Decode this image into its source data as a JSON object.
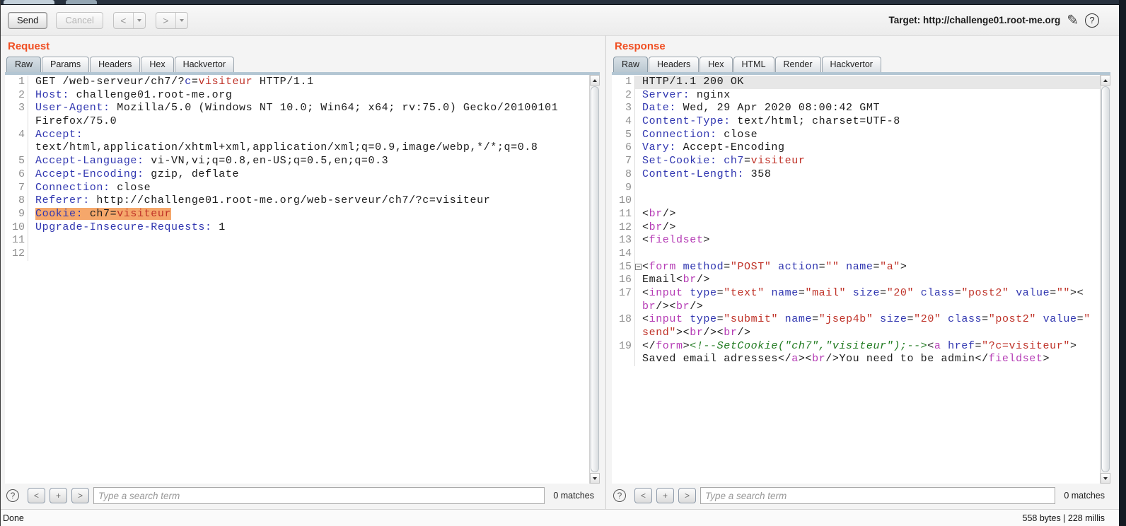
{
  "toolbar": {
    "send_label": "Send",
    "cancel_label": "Cancel",
    "prev_label": "<",
    "next_label": ">",
    "target_label": "Target: http://challenge01.root-me.org"
  },
  "request": {
    "title": "Request",
    "tabs": [
      {
        "label": "Raw",
        "active": true
      },
      {
        "label": "Params"
      },
      {
        "label": "Headers"
      },
      {
        "label": "Hex"
      },
      {
        "label": "Hackvertor"
      }
    ],
    "rows": [
      {
        "n": "1",
        "tk": [
          [
            "GET /web-serveur/ch7/?",
            "t"
          ],
          [
            "c",
            "h"
          ],
          [
            "=",
            "t"
          ],
          [
            "visiteur",
            "v"
          ],
          [
            " HTTP/1.1",
            "t"
          ]
        ]
      },
      {
        "n": "2",
        "tk": [
          [
            "Host:",
            "h"
          ],
          [
            " challenge01.root-me.org",
            "t"
          ]
        ]
      },
      {
        "n": "3",
        "tk": [
          [
            "User-Agent:",
            "h"
          ],
          [
            " Mozilla/5.0 (Windows NT 10.0; Win64; x64; rv:75.0) Gecko/20100101",
            "t"
          ]
        ]
      },
      {
        "n": "",
        "tk": [
          [
            "Firefox/75.0",
            "t"
          ]
        ]
      },
      {
        "n": "4",
        "tk": [
          [
            "Accept:",
            "h"
          ]
        ]
      },
      {
        "n": "",
        "tk": [
          [
            "text/html,application/xhtml+xml,application/xml;q=0.9,image/webp,*/*;q=0.8",
            "t"
          ]
        ]
      },
      {
        "n": "5",
        "tk": [
          [
            "Accept-Language:",
            "h"
          ],
          [
            " vi-VN,vi;q=0.8,en-US;q=0.5,en;q=0.3",
            "t"
          ]
        ]
      },
      {
        "n": "6",
        "tk": [
          [
            "Accept-Encoding:",
            "h"
          ],
          [
            " gzip, deflate",
            "t"
          ]
        ]
      },
      {
        "n": "7",
        "tk": [
          [
            "Connection:",
            "h"
          ],
          [
            " close",
            "t"
          ]
        ]
      },
      {
        "n": "8",
        "tk": [
          [
            "Referer:",
            "h"
          ],
          [
            " http://challenge01.root-me.org/web-serveur/ch7/?c=visiteur",
            "t"
          ]
        ]
      },
      {
        "n": "9",
        "hl": true,
        "tk": [
          [
            "Cookie:",
            "h"
          ],
          [
            " ch7=",
            "t"
          ],
          [
            "visiteur",
            "v"
          ]
        ]
      },
      {
        "n": "10",
        "tk": [
          [
            "Upgrade-Insecure-Requests:",
            "h"
          ],
          [
            " 1",
            "t"
          ]
        ]
      },
      {
        "n": "11",
        "tk": []
      },
      {
        "n": "12",
        "tk": []
      }
    ],
    "search": {
      "prev": "<",
      "case": "+",
      "next": ">",
      "placeholder": "Type a search term",
      "matches": "0 matches"
    }
  },
  "response": {
    "title": "Response",
    "tabs": [
      {
        "label": "Raw",
        "active": true
      },
      {
        "label": "Headers"
      },
      {
        "label": "Hex"
      },
      {
        "label": "HTML"
      },
      {
        "label": "Render"
      },
      {
        "label": "Hackvertor"
      }
    ],
    "rows": [
      {
        "n": "1",
        "cur": true,
        "tk": [
          [
            "HTTP/1.1 200 OK",
            "t"
          ]
        ]
      },
      {
        "n": "2",
        "tk": [
          [
            "Server:",
            "h"
          ],
          [
            " nginx",
            "t"
          ]
        ]
      },
      {
        "n": "3",
        "tk": [
          [
            "Date:",
            "h"
          ],
          [
            " Wed, 29 Apr 2020 08:00:42 GMT",
            "t"
          ]
        ]
      },
      {
        "n": "4",
        "tk": [
          [
            "Content-Type:",
            "h"
          ],
          [
            " text/html; charset=UTF-8",
            "t"
          ]
        ]
      },
      {
        "n": "5",
        "tk": [
          [
            "Connection:",
            "h"
          ],
          [
            " close",
            "t"
          ]
        ]
      },
      {
        "n": "6",
        "tk": [
          [
            "Vary:",
            "h"
          ],
          [
            " Accept-Encoding",
            "t"
          ]
        ]
      },
      {
        "n": "7",
        "tk": [
          [
            "Set-Cookie:",
            "h"
          ],
          [
            " ",
            "t"
          ],
          [
            "ch7",
            "h"
          ],
          [
            "=",
            "t"
          ],
          [
            "visiteur",
            "v"
          ]
        ]
      },
      {
        "n": "8",
        "tk": [
          [
            "Content-Length:",
            "h"
          ],
          [
            " 358",
            "t"
          ]
        ]
      },
      {
        "n": "9",
        "tk": []
      },
      {
        "n": "10",
        "tk": []
      },
      {
        "n": "11",
        "tk": [
          [
            "<",
            "t"
          ],
          [
            "br",
            "g"
          ],
          [
            "/>",
            "t"
          ]
        ]
      },
      {
        "n": "12",
        "tk": [
          [
            "<",
            "t"
          ],
          [
            "br",
            "g"
          ],
          [
            "/>",
            "t"
          ]
        ]
      },
      {
        "n": "13",
        "tk": [
          [
            "<",
            "t"
          ],
          [
            "fieldset",
            "g"
          ],
          [
            ">",
            "t"
          ]
        ]
      },
      {
        "n": "14",
        "tk": []
      },
      {
        "n": "15",
        "fold": true,
        "tk": [
          [
            "<",
            "t"
          ],
          [
            "form",
            "g"
          ],
          [
            " ",
            "t"
          ],
          [
            "method",
            "h"
          ],
          [
            "=",
            "t"
          ],
          [
            "\"POST\"",
            "v"
          ],
          [
            " ",
            "t"
          ],
          [
            "action",
            "h"
          ],
          [
            "=",
            "t"
          ],
          [
            "\"\"",
            "v"
          ],
          [
            " ",
            "t"
          ],
          [
            "name",
            "h"
          ],
          [
            "=",
            "t"
          ],
          [
            "\"a\"",
            "v"
          ],
          [
            ">",
            "t"
          ]
        ]
      },
      {
        "n": "16",
        "tk": [
          [
            "Email",
            "t"
          ],
          [
            "<",
            "t"
          ],
          [
            "br",
            "g"
          ],
          [
            "/>",
            "t"
          ]
        ]
      },
      {
        "n": "17",
        "tk": [
          [
            "<",
            "t"
          ],
          [
            "input",
            "g"
          ],
          [
            " ",
            "t"
          ],
          [
            "type",
            "h"
          ],
          [
            "=",
            "t"
          ],
          [
            "\"text\"",
            "v"
          ],
          [
            " ",
            "t"
          ],
          [
            "name",
            "h"
          ],
          [
            "=",
            "t"
          ],
          [
            "\"mail\"",
            "v"
          ],
          [
            " ",
            "t"
          ],
          [
            "size",
            "h"
          ],
          [
            "=",
            "t"
          ],
          [
            "\"20\"",
            "v"
          ],
          [
            " ",
            "t"
          ],
          [
            "class",
            "h"
          ],
          [
            "=",
            "t"
          ],
          [
            "\"post2\"",
            "v"
          ],
          [
            " ",
            "t"
          ],
          [
            "value",
            "h"
          ],
          [
            "=",
            "t"
          ],
          [
            "\"\"",
            "v"
          ],
          [
            "><",
            "t"
          ]
        ]
      },
      {
        "n": "",
        "tk": [
          [
            "br",
            "g"
          ],
          [
            "/><",
            "t"
          ],
          [
            "br",
            "g"
          ],
          [
            "/>",
            "t"
          ]
        ]
      },
      {
        "n": "18",
        "tk": [
          [
            "<",
            "t"
          ],
          [
            "input",
            "g"
          ],
          [
            " ",
            "t"
          ],
          [
            "type",
            "h"
          ],
          [
            "=",
            "t"
          ],
          [
            "\"submit\"",
            "v"
          ],
          [
            " ",
            "t"
          ],
          [
            "name",
            "h"
          ],
          [
            "=",
            "t"
          ],
          [
            "\"jsep4b\"",
            "v"
          ],
          [
            " ",
            "t"
          ],
          [
            "size",
            "h"
          ],
          [
            "=",
            "t"
          ],
          [
            "\"20\"",
            "v"
          ],
          [
            " ",
            "t"
          ],
          [
            "class",
            "h"
          ],
          [
            "=",
            "t"
          ],
          [
            "\"post2\"",
            "v"
          ],
          [
            " ",
            "t"
          ],
          [
            "value",
            "h"
          ],
          [
            "=",
            "t"
          ],
          [
            "\"",
            "v"
          ]
        ]
      },
      {
        "n": "",
        "tk": [
          [
            "send\"",
            "v"
          ],
          [
            "><",
            "t"
          ],
          [
            "br",
            "g"
          ],
          [
            "/><",
            "t"
          ],
          [
            "br",
            "g"
          ],
          [
            "/>",
            "t"
          ]
        ]
      },
      {
        "n": "19",
        "tk": [
          [
            "</",
            "t"
          ],
          [
            "form",
            "g"
          ],
          [
            ">",
            "t"
          ],
          [
            "<!--SetCookie(\"ch7\",\"visiteur\");-->",
            "c"
          ],
          [
            "<",
            "t"
          ],
          [
            "a",
            "g"
          ],
          [
            " ",
            "t"
          ],
          [
            "href",
            "h"
          ],
          [
            "=",
            "t"
          ],
          [
            "\"?c=visiteur\"",
            "v"
          ],
          [
            ">",
            "t"
          ]
        ]
      },
      {
        "n": "",
        "tk": [
          [
            "Saved email adresses",
            "t"
          ],
          [
            "</",
            "t"
          ],
          [
            "a",
            "g"
          ],
          [
            ">",
            "t"
          ],
          [
            "<",
            "t"
          ],
          [
            "br",
            "g"
          ],
          [
            "/>",
            "t"
          ],
          [
            "You need to be admin",
            "t"
          ],
          [
            "</",
            "t"
          ],
          [
            "fieldset",
            "g"
          ],
          [
            ">",
            "t"
          ]
        ]
      }
    ],
    "search": {
      "prev": "<",
      "case": "+",
      "next": ">",
      "placeholder": "Type a search term",
      "matches": "0 matches"
    }
  },
  "status": {
    "left": "Done",
    "right": "558 bytes | 228 millis"
  },
  "colors": {
    "accent_orange": "#f04f23",
    "highlight": "#f5a76b",
    "header_blue": "#3036b0",
    "value_red": "#bf3127",
    "tag_magenta": "#b53bb5",
    "comment_green": "#1f7a1f"
  }
}
